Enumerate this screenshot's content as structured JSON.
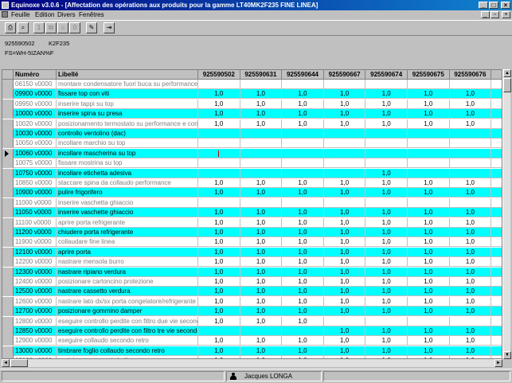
{
  "window": {
    "title": "Equinoxe v3.0.6 - [Affectation des opérations aux produits pour la gamme LT40MK2F235 FINE LINEA]",
    "controls": {
      "min": "_",
      "max": "□",
      "close": "×"
    },
    "mdi_controls": {
      "min": "_",
      "restore": "▫",
      "close": "×"
    }
  },
  "menu": {
    "items": [
      "Feuille",
      "Edition",
      "Divers",
      "Fenêtres"
    ]
  },
  "toolbar": {
    "buttons": [
      {
        "icon": "print-icon",
        "glyph": "⎙",
        "enabled": true
      },
      {
        "icon": "zoom-icon",
        "glyph": "⌕",
        "enabled": true
      },
      {
        "icon": "one-icon",
        "glyph": "1",
        "enabled": false
      },
      {
        "icon": "copy-icon",
        "glyph": "⧉",
        "enabled": false
      },
      {
        "icon": "stamp-icon",
        "glyph": "⌂",
        "enabled": false
      },
      {
        "icon": "zero-icon",
        "glyph": "0",
        "enabled": false
      },
      {
        "icon": "edit-icon",
        "glyph": "✎",
        "enabled": true
      },
      {
        "icon": "exit-icon",
        "glyph": "⇥",
        "enabled": true
      }
    ]
  },
  "header": {
    "code": "925590502",
    "model": "K2F235",
    "filter": "FS=WH-5IZAN%F"
  },
  "grid": {
    "columns": {
      "numero": "Numéro",
      "libelle": "Libellé",
      "products": [
        "925590502",
        "925590631",
        "925590644",
        "925590667",
        "925590674",
        "925590675",
        "925590676",
        "92"
      ]
    },
    "rows": [
      {
        "numero": "06150 v0000",
        "libelle": "montare condensatore fuori buca su performance",
        "style": "white",
        "inactive": true,
        "values": [
          "",
          "",
          "",
          "",
          "",
          "",
          "",
          ""
        ]
      },
      {
        "numero": "09900 v0000",
        "libelle": "fissare top con viti",
        "style": "cyan",
        "inactive": false,
        "values": [
          "1,0",
          "1,0",
          "1,0",
          "1,0",
          "1,0",
          "1,0",
          "1,0",
          ""
        ]
      },
      {
        "numero": "09950 v0000",
        "libelle": "inserire tappi su top",
        "style": "white",
        "inactive": true,
        "values": [
          "1,0",
          "1,0",
          "1,0",
          "1,0",
          "1,0",
          "1,0",
          "1,0",
          ""
        ]
      },
      {
        "numero": "10000 v0000",
        "libelle": "inserire spina su presa",
        "style": "cyan",
        "inactive": false,
        "values": [
          "1,0",
          "1,0",
          "1,0",
          "1,0",
          "1,0",
          "1,0",
          "1,0",
          ""
        ]
      },
      {
        "numero": "10020 v0000",
        "libelle": "posizionamento termostato su performance e controllo",
        "style": "white",
        "inactive": true,
        "values": [
          "1,0",
          "1,0",
          "1,0",
          "1,0",
          "1,0",
          "1,0",
          "1,0",
          ""
        ]
      },
      {
        "numero": "10030 v0000",
        "libelle": "controllo ventolino (dac)",
        "style": "cyan",
        "inactive": false,
        "values": [
          "",
          "",
          "",
          "",
          "",
          "",
          "",
          ""
        ]
      },
      {
        "numero": "10050 v0000",
        "libelle": "incollare marchio su top",
        "style": "white",
        "inactive": true,
        "values": [
          "",
          "",
          "",
          "",
          "",
          "",
          "",
          ""
        ]
      },
      {
        "numero": "10060 v0000",
        "libelle": "incollare mascherina su top",
        "style": "cyan",
        "inactive": false,
        "current": true,
        "values": [
          "|",
          "",
          "",
          "",
          "",
          "",
          "",
          ""
        ]
      },
      {
        "numero": "10075 v0000",
        "libelle": "fissare mostrina su top",
        "style": "white",
        "inactive": true,
        "values": [
          "",
          "",
          "",
          "",
          "",
          "",
          "",
          ""
        ]
      },
      {
        "numero": "10750 v0000",
        "libelle": "incollare etichetta adesiva",
        "style": "cyan",
        "inactive": false,
        "values": [
          "",
          "",
          "",
          "",
          "1,0",
          "",
          "",
          ""
        ]
      },
      {
        "numero": "10850 v0000",
        "libelle": "staccare spina da collaudo performance",
        "style": "white",
        "inactive": true,
        "values": [
          "1,0",
          "1,0",
          "1,0",
          "1,0",
          "1,0",
          "1,0",
          "1,0",
          ""
        ]
      },
      {
        "numero": "10900 v0000",
        "libelle": "pulire frigorifero",
        "style": "cyan",
        "inactive": false,
        "values": [
          "1,0",
          "1,0",
          "1,0",
          "1,0",
          "1,0",
          "1,0",
          "1,0",
          ""
        ]
      },
      {
        "numero": "11000 v0000",
        "libelle": "inserire vaschetta ghiaccio",
        "style": "white",
        "inactive": true,
        "values": [
          "",
          "",
          "",
          "",
          "",
          "",
          "",
          ""
        ]
      },
      {
        "numero": "11050 v0000",
        "libelle": "inserire vaschette ghiaccio",
        "style": "cyan",
        "inactive": false,
        "values": [
          "1,0",
          "1,0",
          "1,0",
          "1,0",
          "1,0",
          "1,0",
          "1,0",
          ""
        ]
      },
      {
        "numero": "11100 v0000",
        "libelle": "aprire porta refrigerante",
        "style": "white",
        "inactive": true,
        "values": [
          "1,0",
          "1,0",
          "1,0",
          "1,0",
          "1,0",
          "1,0",
          "1,0",
          ""
        ]
      },
      {
        "numero": "11200 v0000",
        "libelle": " chiudere porta refrigerante",
        "style": "cyan",
        "inactive": false,
        "values": [
          "1,0",
          "1,0",
          "1,0",
          "1,0",
          "1,0",
          "1,0",
          "1,0",
          ""
        ]
      },
      {
        "numero": "11900 v0000",
        "libelle": "collaudare fine linea",
        "style": "white",
        "inactive": true,
        "values": [
          "1,0",
          "1,0",
          "1,0",
          "1,0",
          "1,0",
          "1,0",
          "1,0",
          ""
        ]
      },
      {
        "numero": "12100 v0000",
        "libelle": "aprire porta",
        "style": "cyan",
        "inactive": false,
        "values": [
          "1,0",
          "1,0",
          "1,0",
          "1,0",
          "1,0",
          "1,0",
          "1,0",
          ""
        ]
      },
      {
        "numero": "12200 v0000",
        "libelle": "nastrare mensola burro",
        "style": "white",
        "inactive": true,
        "values": [
          "1,0",
          "1,0",
          "1,0",
          "1,0",
          "1,0",
          "1,0",
          "1,0",
          ""
        ]
      },
      {
        "numero": "12300 v0000",
        "libelle": "nastrare ripiano verdura",
        "style": "cyan",
        "inactive": false,
        "values": [
          "1,0",
          "1,0",
          "1,0",
          "1,0",
          "1,0",
          "1,0",
          "1,0",
          ""
        ]
      },
      {
        "numero": "12400 v0000",
        "libelle": "posizionare cartoncino protezione",
        "style": "white",
        "inactive": true,
        "values": [
          "1,0",
          "1,0",
          "1,0",
          "1,0",
          "1,0",
          "1,0",
          "1,0",
          ""
        ]
      },
      {
        "numero": "12500 v0000",
        "libelle": "nastrare cassetto verdura",
        "style": "cyan",
        "inactive": false,
        "values": [
          "1,0",
          "1,0",
          "1,0",
          "1,0",
          "1,0",
          "1,0",
          "1,0",
          ""
        ]
      },
      {
        "numero": "12600 v0000",
        "libelle": "nastrare lato dx/sx porta congelatore/refrigerante",
        "style": "white",
        "inactive": true,
        "values": [
          "1,0",
          "1,0",
          "1,0",
          "1,0",
          "1,0",
          "1,0",
          "1,0",
          ""
        ]
      },
      {
        "numero": "12700 v0000",
        "libelle": "posizionare gommino damper",
        "style": "cyan",
        "inactive": false,
        "values": [
          "1,0",
          "1,0",
          "1,0",
          "1,0",
          "1,0",
          "1,0",
          "1,0",
          ""
        ]
      },
      {
        "numero": "12800 v0000",
        "libelle": "eseguire controllo perdite con filtro due vie secondo",
        "style": "white",
        "inactive": true,
        "values": [
          "1,0",
          "1,0",
          "1,0",
          "",
          "",
          "",
          "",
          ""
        ]
      },
      {
        "numero": "12850 v0000",
        "libelle": "eseguire controllo perdite con filtro tre vie secondo retro",
        "style": "cyan",
        "inactive": false,
        "values": [
          "",
          "",
          "",
          "1,0",
          "1,0",
          "1,0",
          "1,0",
          ""
        ]
      },
      {
        "numero": "12900 v0000",
        "libelle": "eseguire collaudo secondo retro",
        "style": "white",
        "inactive": true,
        "values": [
          "1,0",
          "1,0",
          "1,0",
          "1,0",
          "1,0",
          "1,0",
          "1,0",
          ""
        ]
      },
      {
        "numero": "13000 v0000",
        "libelle": "timbrare foglio collaudo secondo retro",
        "style": "cyan",
        "inactive": false,
        "values": [
          "1,0",
          "1,0",
          "1,0",
          "1,0",
          "1,0",
          "1,0",
          "1,0",
          ""
        ]
      },
      {
        "numero": "13100 v0000",
        "libelle": "posizionare sacco imballo corto",
        "style": "white",
        "inactive": true,
        "values": [
          "1,0",
          "1,0",
          "1,0",
          "1,0",
          "1,0",
          "1,0",
          "1,0",
          ""
        ]
      }
    ]
  },
  "status": {
    "user": "Jacques LONGA",
    "user_icon": "user-icon"
  },
  "scrollbars": {
    "up": "▲",
    "down": "▼",
    "left": "◄",
    "right": "►"
  }
}
